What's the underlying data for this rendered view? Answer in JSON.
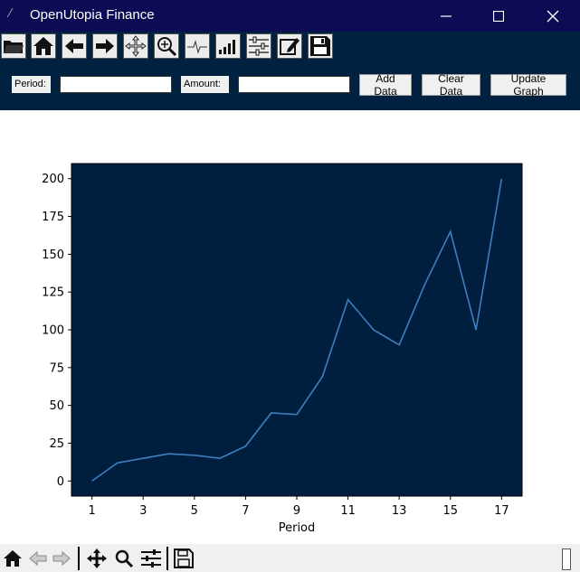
{
  "window": {
    "title": "OpenUtopia Finance",
    "icon": "feather-icon",
    "controls": [
      "minimize-icon",
      "maximize-icon",
      "close-icon"
    ]
  },
  "toolbar": {
    "icons": [
      "open-folder-icon",
      "home-icon",
      "back-arrow-icon",
      "forward-arrow-icon",
      "pan-icon",
      "zoom-icon",
      "subplots-icon",
      "bar-chart-icon",
      "sliders-icon",
      "edit-icon",
      "save-icon"
    ]
  },
  "form": {
    "period_label": "Period:",
    "period_value": "",
    "amount_label": "Amount:",
    "amount_value": "",
    "add_label": "Add Data",
    "clear_label": "Clear Data",
    "update_label": "Update Graph"
  },
  "colors": {
    "title_bar": "#0c0b53",
    "panel": "#002140",
    "plot_bg": "#001f3f",
    "line": "#3f7fbf"
  },
  "chart_data": {
    "type": "line",
    "x": [
      1,
      2,
      3,
      4,
      5,
      6,
      7,
      8,
      9,
      10,
      11,
      12,
      13,
      14,
      15,
      16,
      17
    ],
    "series": [
      {
        "values": [
          0,
          12,
          15,
          18,
          17,
          15,
          23,
          45,
          44,
          69,
          120,
          100,
          90,
          130,
          165,
          100,
          200
        ]
      }
    ],
    "xlabel": "Period",
    "ylabel": "",
    "xticks": [
      1,
      3,
      5,
      7,
      9,
      11,
      13,
      15,
      17
    ],
    "yticks": [
      0,
      25,
      50,
      75,
      100,
      125,
      150,
      175,
      200
    ],
    "xlim": [
      0.2,
      17.8
    ],
    "ylim": [
      -10,
      210
    ],
    "grid": false
  },
  "bottom_toolbar": {
    "icons": [
      "home-icon",
      "back-arrow-icon",
      "forward-arrow-icon",
      "pan-icon",
      "zoom-icon",
      "sliders-icon",
      "save-icon"
    ]
  }
}
